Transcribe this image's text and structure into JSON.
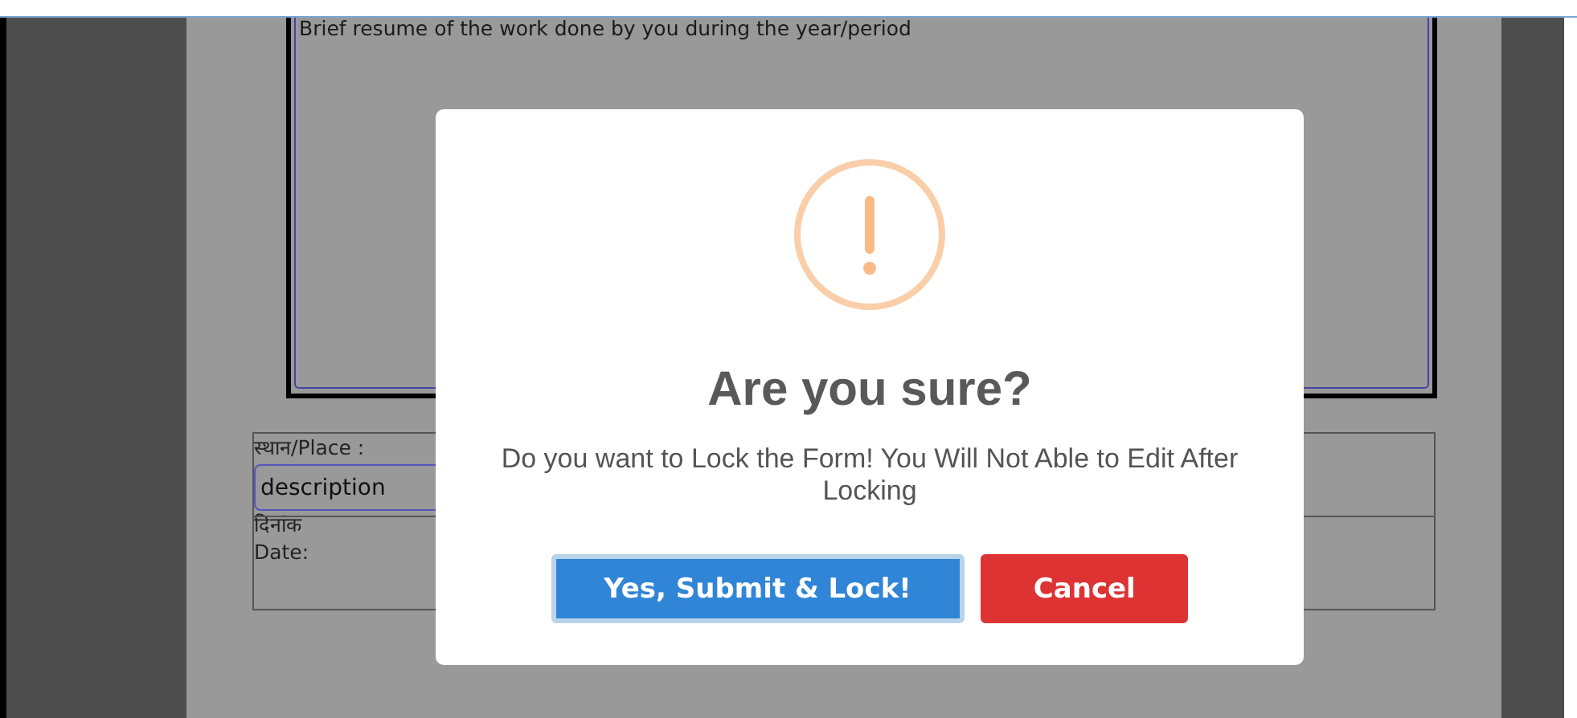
{
  "form": {
    "resume_text": "Brief resume of the work done by you during the year/period",
    "place_label": "स्थान/Place :",
    "place_value": "description",
    "date_label_hindi": "दिनांक",
    "date_label": "Date:"
  },
  "dialog": {
    "title": "Are you sure?",
    "message": "Do you want to Lock the Form! You Will Not Able to Edit After Locking",
    "buttons": [
      {
        "label": "Yes, Submit & Lock!",
        "kind": "confirm",
        "focused": true
      },
      {
        "label": "Cancel",
        "kind": "cancel",
        "focused": false
      }
    ]
  }
}
